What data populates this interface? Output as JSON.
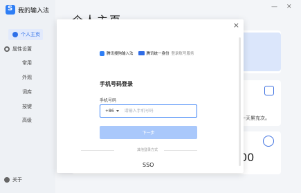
{
  "app": {
    "title": "我的输入法"
  },
  "window": {
    "minimize": "—",
    "close": "✕"
  },
  "sidebar": {
    "items": [
      {
        "label": "个人主页",
        "icon": "person-icon"
      },
      {
        "label": "属性设置",
        "icon": "gear-icon"
      },
      {
        "label": "常用"
      },
      {
        "label": "外观"
      },
      {
        "label": "词库"
      },
      {
        "label": "按键"
      },
      {
        "label": "高级"
      },
      {
        "label": "关于",
        "icon": "info-icon"
      }
    ]
  },
  "background": {
    "page_title": "个人主页",
    "card_text": "一天累充次。",
    "big_value": "00"
  },
  "modal": {
    "close": "×",
    "brand1": "腾讯搜狗输入法",
    "brand2": "腾讯统一身份",
    "brand2_suffix": "登录账号服务",
    "login_title": "手机号码登录",
    "field_label": "手机号码",
    "country_code": "+86",
    "phone_placeholder": "请输入手机号码",
    "next_button": "下一步",
    "other_methods": "其他登录方式",
    "sso": "SSO"
  },
  "colors": {
    "accent": "#2e6fe8",
    "button_disabled": "#a9c8fb"
  }
}
